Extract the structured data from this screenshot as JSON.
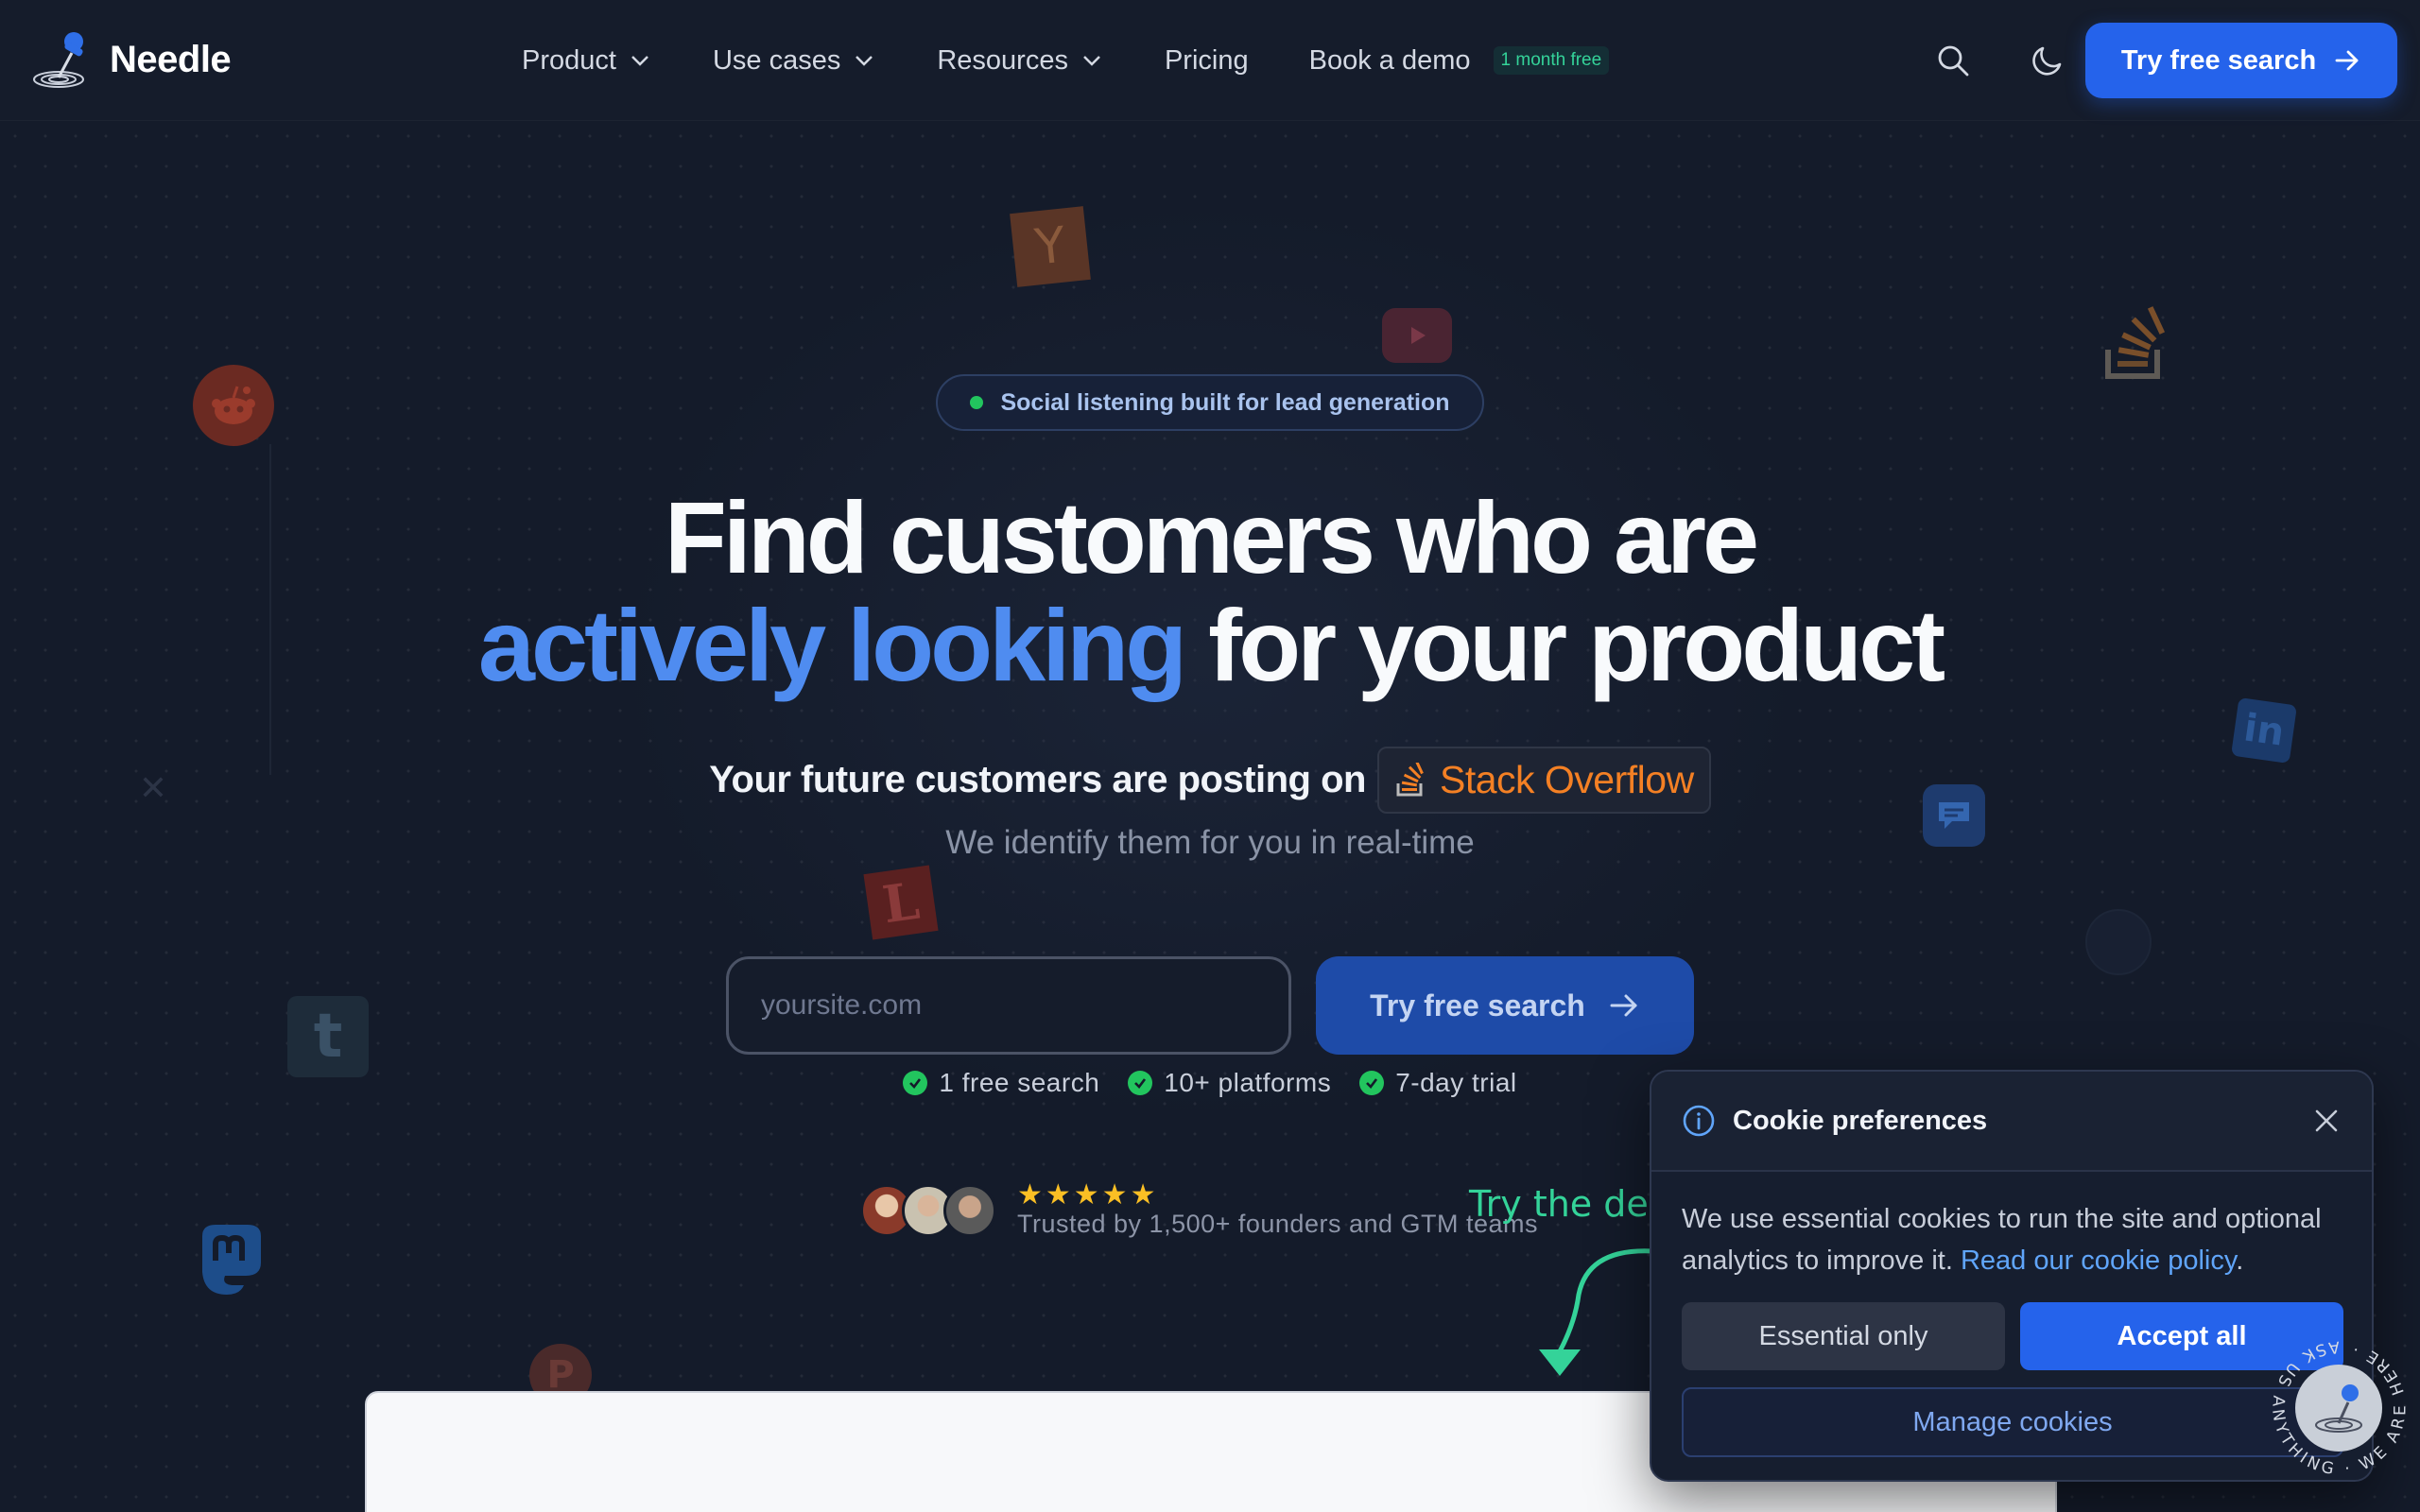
{
  "nav": {
    "brand": "Needle",
    "links": [
      {
        "label": "Product",
        "dropdown": true
      },
      {
        "label": "Use cases",
        "dropdown": true
      },
      {
        "label": "Resources",
        "dropdown": true
      },
      {
        "label": "Pricing",
        "dropdown": false
      },
      {
        "label": "Book a demo",
        "dropdown": false,
        "badge": "1 month free"
      }
    ],
    "cta": "Try free search",
    "icons": [
      "search-icon",
      "moon-icon",
      "arrow-right-icon",
      "chevron-down-icon"
    ]
  },
  "hero": {
    "pill": "Social listening built for lead generation",
    "headline_line1": "Find customers who are",
    "headline_blue": "actively looking",
    "headline_rest": "for your product",
    "subline_prefix": "Your future customers are posting on",
    "platform": "Stack Overflow",
    "tagline": "We identify them for you in real-time",
    "input_placeholder": "yoursite.com",
    "button": "Try free search",
    "checks": [
      "1 free search",
      "10+ platforms",
      "7-day trial"
    ],
    "stars": "★★★★★",
    "trust": "Trusted by 1,500+ founders and GTM teams",
    "demo_hint": "Try the dem"
  },
  "floating_icons": [
    "reddit-icon",
    "hacker-news-icon",
    "youtube-icon",
    "stack-overflow-icon",
    "linkedin-icon",
    "chat-icon",
    "lobsters-icon",
    "tumblr-icon",
    "mastodon-icon",
    "product-hunt-icon",
    "x-icon",
    "github-icon"
  ],
  "floating_letters": {
    "hn": "Y",
    "lobsters": "L",
    "tumblr": "t",
    "producthunt": "P",
    "x": "✕"
  },
  "cookie": {
    "title": "Cookie preferences",
    "body": "We use essential cookies to run the site and optional analytics to improve it.",
    "link": "Read our cookie policy",
    "period": ".",
    "essential": "Essential only",
    "accept": "Accept all",
    "manage": "Manage cookies"
  },
  "chat": {
    "ring_text": "ASK US ANYTHING · WE ARE HERE ·"
  },
  "colors": {
    "background": "#141b2a",
    "accent": "#2563eb",
    "headline_blue": "#4f8cf0",
    "stack_overflow": "#f48024",
    "success": "#22c55e"
  }
}
